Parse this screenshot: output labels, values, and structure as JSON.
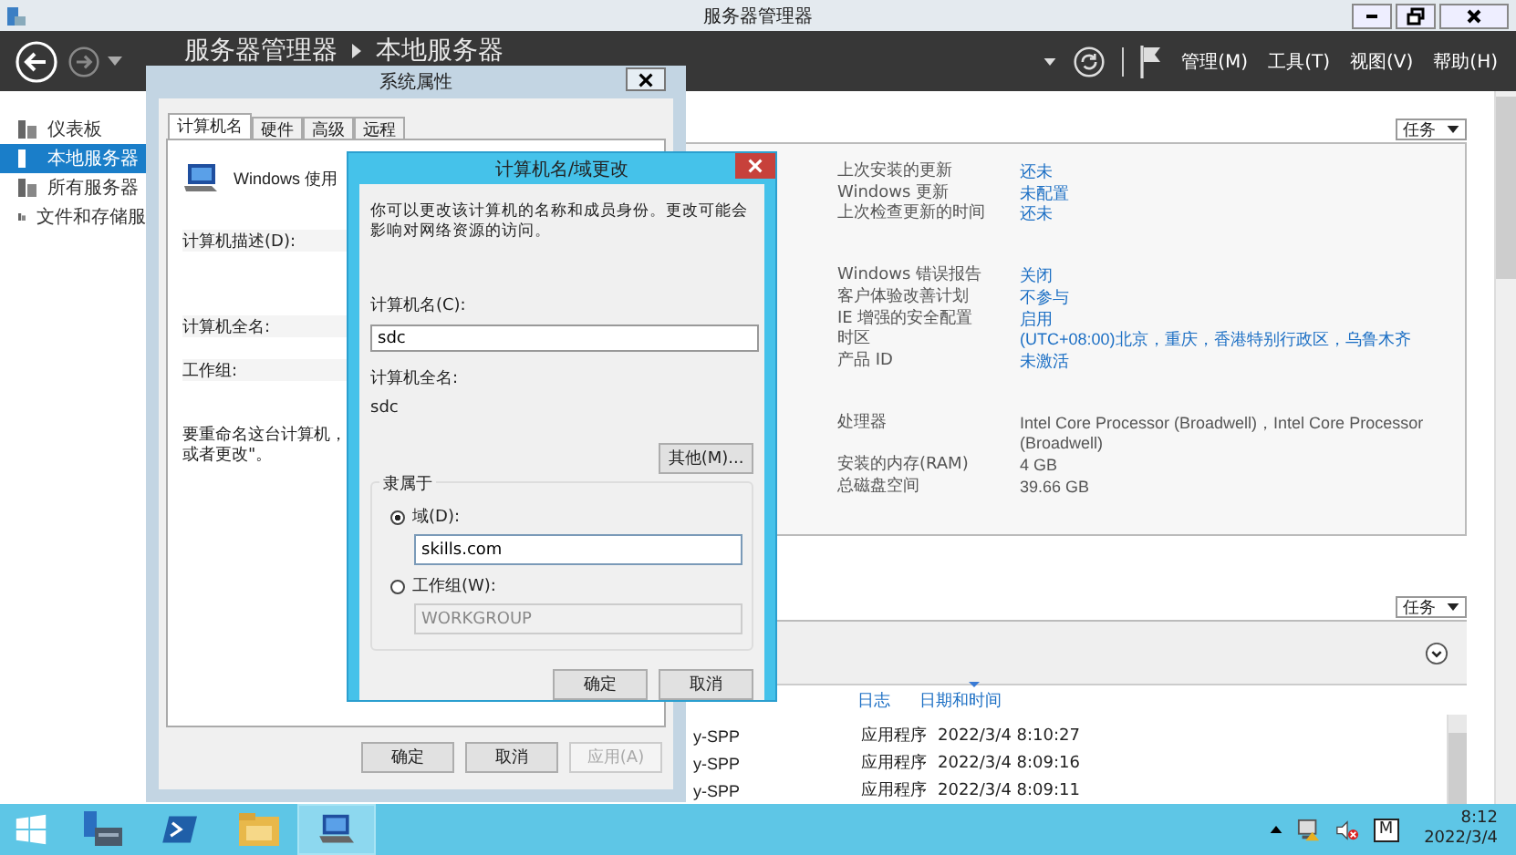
{
  "window": {
    "title": "服务器管理器"
  },
  "header": {
    "breadcrumb": [
      "服务器管理器",
      "本地服务器"
    ],
    "menus": [
      "管理(M)",
      "工具(T)",
      "视图(V)",
      "帮助(H)"
    ]
  },
  "sidebar": {
    "items": [
      {
        "label": "仪表板",
        "selected": false
      },
      {
        "label": "本地服务器",
        "selected": true
      },
      {
        "label": "所有服务器",
        "selected": false
      },
      {
        "label": "文件和存储服",
        "selected": false
      }
    ]
  },
  "properties": {
    "tasks_button": "任务",
    "groups": [
      [
        {
          "label": "上次安装的更新",
          "value": "还未",
          "link": true
        },
        {
          "label": "Windows 更新",
          "value": "未配置",
          "link": true
        },
        {
          "label": "上次检查更新的时间",
          "value": "还未",
          "link": true
        }
      ],
      [
        {
          "label": "Windows 错误报告",
          "value": "关闭",
          "link": true
        },
        {
          "label": "客户体验改善计划",
          "value": "不参与",
          "link": true
        },
        {
          "label": "IE 增强的安全配置",
          "value": "启用",
          "link": true
        },
        {
          "label": "时区",
          "value": "(UTC+08:00)北京，重庆，香港特别行政区，乌鲁木齐",
          "link": true
        },
        {
          "label": "产品 ID",
          "value": "未激活",
          "link": true
        }
      ],
      [
        {
          "label": "处理器",
          "value": "Intel Core Processor (Broadwell)，Intel Core Processor (Broadwell)",
          "link": false
        },
        {
          "label": "安装的内存(RAM)",
          "value": "4 GB",
          "link": false
        },
        {
          "label": "总磁盘空间",
          "value": "39.66 GB",
          "link": false
        }
      ]
    ]
  },
  "events": {
    "tasks_button": "任务",
    "columns": [
      "日志",
      "日期和时间"
    ],
    "rows": [
      {
        "source": "y-SPP",
        "log": "应用程序",
        "datetime": "2022/3/4 8:10:27"
      },
      {
        "source": "y-SPP",
        "log": "应用程序",
        "datetime": "2022/3/4 8:09:16"
      },
      {
        "source": "y-SPP",
        "log": "应用程序",
        "datetime": "2022/3/4 8:09:11"
      }
    ]
  },
  "system_dialog": {
    "title": "系统属性",
    "tabs": [
      {
        "label": "计算机名",
        "selected": true
      },
      {
        "label": "硬件",
        "selected": false
      },
      {
        "label": "高级",
        "selected": false
      },
      {
        "label": "远程",
        "selected": false
      }
    ],
    "intro": "Windows 使用",
    "description_label": "计算机描述(D):",
    "full_name_label": "计算机全名:",
    "workgroup_label": "工作组:",
    "rename_note": "要重命名这台计算机，或者更改\"。",
    "buttons": [
      {
        "label": "确定",
        "disabled": false
      },
      {
        "label": "取消",
        "disabled": false
      },
      {
        "label": "应用(A)",
        "disabled": true
      }
    ]
  },
  "change_dialog": {
    "title": "计算机名/域更改",
    "intro": "你可以更改该计算机的名称和成员身份。更改可能会影响对网络资源的访问。",
    "name_label": "计算机名(C):",
    "name_value": "sdc",
    "full_name_label": "计算机全名:",
    "full_name": "sdc",
    "more_button": "其他(M)...",
    "member_group": "隶属于",
    "options": [
      {
        "label": "域(D):",
        "selected": true,
        "value": "skills.com",
        "disabled": false
      },
      {
        "label": "工作组(W):",
        "selected": false,
        "value": "WORKGROUP",
        "disabled": true
      }
    ],
    "buttons": [
      "确定",
      "取消"
    ]
  },
  "taskbar": {
    "apps": [
      {
        "kind": "server-manager",
        "selected": false
      },
      {
        "kind": "powershell",
        "selected": false
      },
      {
        "kind": "explorer",
        "selected": false
      },
      {
        "kind": "system",
        "selected": true
      }
    ],
    "tray_label": "M",
    "time": "8:12",
    "date": "2022/3/4"
  }
}
